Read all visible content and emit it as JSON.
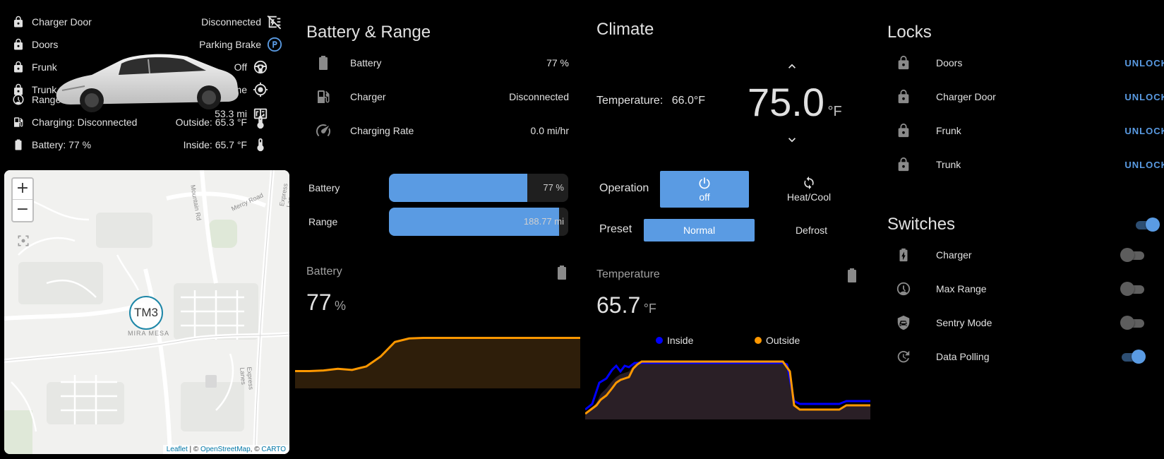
{
  "status": {
    "left": [
      {
        "label": "Charger Door",
        "icon": "lock-icon"
      },
      {
        "label": "Doors",
        "icon": "lock-icon"
      },
      {
        "label": "Frunk",
        "icon": "lock-icon"
      },
      {
        "label": "Trunk",
        "icon": "lock-icon"
      },
      {
        "label": "Range: 188.77 mi",
        "icon": "gauge-icon"
      },
      {
        "label": "Charging: Disconnected",
        "icon": "ev-station-icon"
      },
      {
        "label": "Battery: 77 %",
        "icon": "battery-icon"
      }
    ],
    "right": [
      {
        "label": "Disconnected",
        "icon": "ev-plug-off-icon"
      },
      {
        "label": "Parking Brake",
        "icon": "parking-brake-icon"
      },
      {
        "label": "Off",
        "icon": "steering-icon"
      },
      {
        "label": "Home",
        "icon": "crosshairs-gps-icon"
      },
      {
        "label": "53.3 mi",
        "icon": "counter-icon"
      },
      {
        "label": "Outside: 65.3 °F",
        "icon": "thermometer-icon"
      },
      {
        "label": "Inside: 65.7 °F",
        "icon": "thermometer-icon"
      }
    ]
  },
  "map": {
    "zoom_in": "+",
    "zoom_out": "−",
    "marker": "TM3",
    "area_label": "MIRA MESA",
    "road_labels": [
      "Mountain Rd",
      "Mercy Road",
      "Express Lanes",
      "Express Lanes"
    ],
    "attribution": {
      "leaflet": "Leaflet",
      "sep1": " | © ",
      "osm": "OpenStreetMap",
      "sep2": ", © ",
      "carto": "CARTO"
    }
  },
  "battery_range": {
    "title": "Battery & Range",
    "rows": [
      {
        "label": "Battery",
        "value": "77 %",
        "icon": "battery-icon"
      },
      {
        "label": "Charger",
        "value": "Disconnected",
        "icon": "ev-station-icon"
      },
      {
        "label": "Charging Rate",
        "value": "0.0 mi/hr",
        "icon": "speedometer-icon"
      }
    ],
    "bars": [
      {
        "label": "Battery",
        "value_text": "77 %",
        "fraction": 0.77
      },
      {
        "label": "Range",
        "value_text": "188.77 mi",
        "fraction": 0.95
      }
    ]
  },
  "battery_sensor": {
    "title": "Battery",
    "value": "77",
    "unit": "%",
    "icon": "battery-icon",
    "history": [
      20,
      20,
      21,
      24,
      22,
      28,
      45,
      70,
      76,
      77,
      77,
      77,
      77,
      77,
      77,
      77,
      77,
      77,
      77,
      77,
      77
    ]
  },
  "climate": {
    "title": "Climate",
    "current_label": "Temperature:",
    "current_value": "66.0°F",
    "target": "75.0",
    "target_unit": "°F",
    "operation_label": "Operation",
    "modes": [
      {
        "label": "off",
        "icon": "power-icon",
        "active": true
      },
      {
        "label": "Heat/Cool",
        "icon": "sync-icon",
        "active": false
      }
    ],
    "preset_label": "Preset",
    "presets": [
      {
        "label": "Normal",
        "active": true
      },
      {
        "label": "Defrost",
        "active": false
      }
    ]
  },
  "temperature_sensor": {
    "title": "Temperature",
    "value": "65.7",
    "unit": "°F",
    "icon": "battery-icon",
    "legend": [
      {
        "name": "Inside",
        "color": "#0000ff"
      },
      {
        "name": "Outside",
        "color": "#ff9800"
      }
    ]
  },
  "locks": {
    "title": "Locks",
    "action_label": "UNLOCK",
    "items": [
      {
        "label": "Doors",
        "icon": "lock-icon"
      },
      {
        "label": "Charger Door",
        "icon": "lock-icon"
      },
      {
        "label": "Frunk",
        "icon": "lock-icon"
      },
      {
        "label": "Trunk",
        "icon": "lock-icon"
      }
    ]
  },
  "switches": {
    "title": "Switches",
    "header_toggle_on": true,
    "items": [
      {
        "label": "Charger",
        "icon": "ev-station-icon",
        "on": false
      },
      {
        "label": "Max Range",
        "icon": "gauge-icon",
        "on": false
      },
      {
        "label": "Sentry Mode",
        "icon": "shield-car-icon",
        "on": false
      },
      {
        "label": "Data Polling",
        "icon": "update-icon",
        "on": true
      }
    ]
  },
  "colors": {
    "accent": "#5a9be3",
    "orange": "#ff9800",
    "blue": "#0000ff"
  }
}
